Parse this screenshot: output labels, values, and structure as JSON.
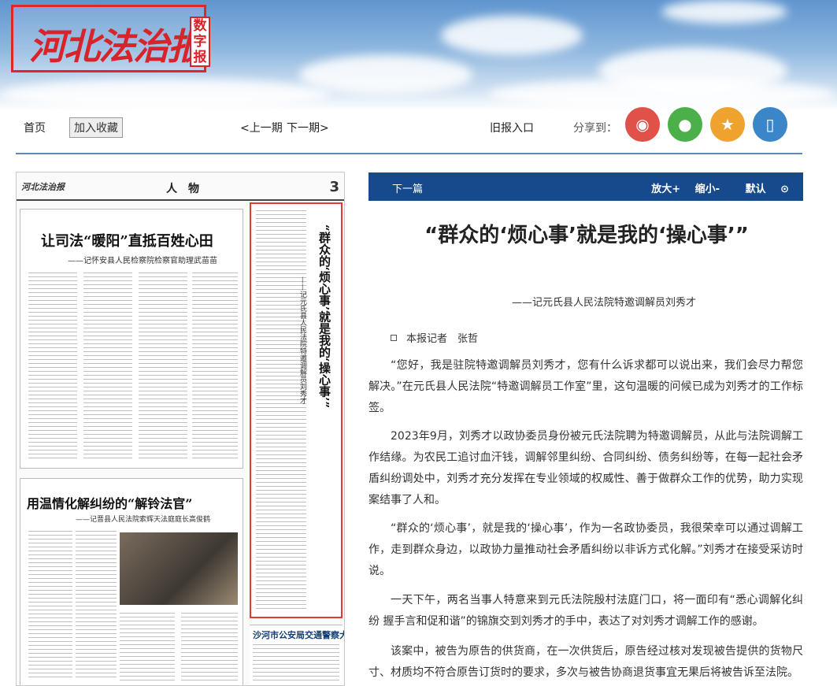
{
  "header": {
    "logo_text": "河北法治报",
    "logo_sub": "数字报"
  },
  "nav": {
    "home": "首页",
    "favorite": "加入收藏",
    "prev_issue": "<上一期",
    "next_issue": "下一期>",
    "archive": "旧报入口",
    "share_label": "分享到：",
    "share_buttons": [
      {
        "icon": "weibo-icon",
        "color": "#e0514a"
      },
      {
        "icon": "wechat-icon",
        "color": "#4cb04a"
      },
      {
        "icon": "qzone-icon",
        "color": "#f0a22f"
      },
      {
        "icon": "mobile-icon",
        "color": "#3a86c8"
      }
    ]
  },
  "paper": {
    "page_label": "人　物",
    "page_number": "3",
    "story1_title": "让司法“暖阳”直抵百姓心田",
    "story1_sub": "——记怀安县人民检察院检察官助理武苗苗",
    "story2_title": "用温情化解纠纷的“解铃法官”",
    "story2_sub": "——记晋县人民法院索辉天法庭庭长高俊鹤",
    "highlight_title": "“群众的‘烦心事’就是我的‘操心事’”",
    "highlight_sub": "——记元氏县人民法院特邀调解员刘秀才",
    "ad_title": "沙河市公安局交通警察大队"
  },
  "article": {
    "toolbar": {
      "next": "下一篇",
      "zoom_in": "放大+",
      "zoom_out": "缩小-",
      "default": "默认"
    },
    "title": "“群众的‘烦心事’就是我的‘操心事’”",
    "subtitle": "——记元氏县人民法院特邀调解员刘秀才",
    "byline": "本报记者　张哲",
    "paragraphs": [
      "“您好，我是驻院特邀调解员刘秀才，您有什么诉求都可以说出来，我们会尽力帮您解决。”在元氏县人民法院“特邀调解员工作室”里，这句温暖的问候已成为刘秀才的工作标签。",
      "2023年9月，刘秀才以政协委员身份被元氏法院聘为特邀调解员，从此与法院调解工作结缘。为农民工追讨血汗钱，调解邻里纠纷、合同纠纷、债务纠纷等，在每一起社会矛盾纠纷调处中，刘秀才充分发挥在专业领域的权威性、善于做群众工作的优势，助力实现案结事了人和。",
      "“群众的‘烦心事’，就是我的‘操心事’，作为一名政协委员，我很荣幸可以通过调解工作，走到群众身边，以政协力量推动社会矛盾纠纷以非诉方式化解。”刘秀才在接受采访时说。",
      "一天下午，两名当事人特意来到元氏法院殷村法庭门口，将一面印有“悉心调解化纠纷 握手言和促和谐”的锦旗交到刘秀才的手中，表达了对刘秀才调解工作的感谢。",
      "该案中，被告为原告的供货商，在一次供货后，原告经过核对发现被告提供的货物尺寸、材质均不符合原告订货时的要求，多次与被告协商退货事宜无果后将被告诉至法院。"
    ]
  }
}
